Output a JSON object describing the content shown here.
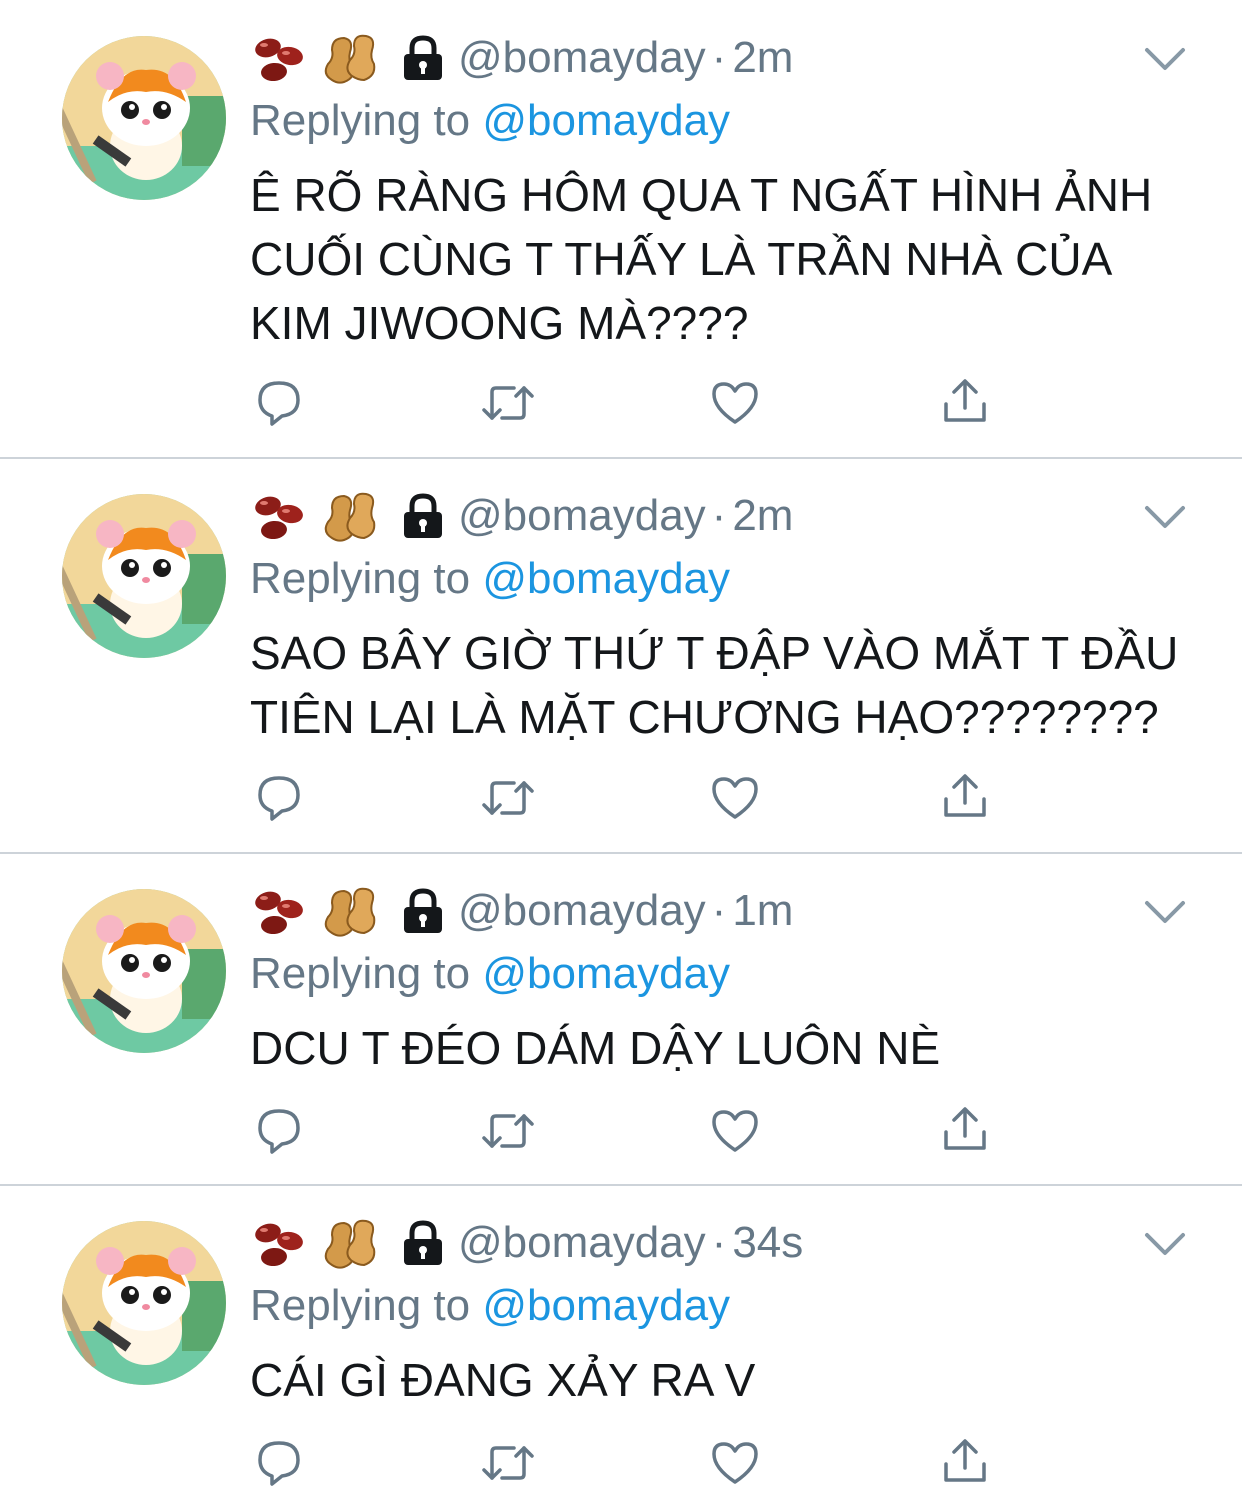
{
  "colors": {
    "text": "#14171a",
    "secondary": "#657786",
    "link": "#1b95e0",
    "divider": "#cdd3d9",
    "icon": "#657786"
  },
  "icons": {
    "emoji_1": "red-beans-emoji",
    "emoji_2": "peanuts-emoji",
    "lock": "lock-icon",
    "caret": "chevron-down-icon",
    "reply": "comment-icon",
    "retweet": "retweet-icon",
    "like": "heart-icon",
    "share": "share-icon"
  },
  "tweets": [
    {
      "handle": "@bomayday",
      "dot": "·",
      "time": "2m",
      "replying_prefix": "Replying to",
      "replying_to": "@bomayday",
      "lines": [
        "Ê RÕ RÀNG HÔM QUA T NGẤT HÌNH ẢNH",
        "CUỐI CÙNG T THẤY LÀ TRẦN NHÀ CỦA",
        "KIM JIWOONG MÀ????"
      ]
    },
    {
      "handle": "@bomayday",
      "dot": "·",
      "time": "2m",
      "replying_prefix": "Replying to",
      "replying_to": "@bomayday",
      "lines": [
        "SAO BÂY GIỜ THỨ T ĐẬP VÀO MẮT T ĐẦU",
        "TIÊN LẠI LÀ MẶT CHƯƠNG HẠO????????"
      ]
    },
    {
      "handle": "@bomayday",
      "dot": "·",
      "time": "1m",
      "replying_prefix": "Replying to",
      "replying_to": "@bomayday",
      "lines": [
        "DCU T ĐÉO DÁM DẬY LUÔN NÈ"
      ]
    },
    {
      "handle": "@bomayday",
      "dot": "·",
      "time": "34s",
      "replying_prefix": "Replying to",
      "replying_to": "@bomayday",
      "lines": [
        "CÁI GÌ ĐANG XẢY RA V"
      ]
    }
  ]
}
